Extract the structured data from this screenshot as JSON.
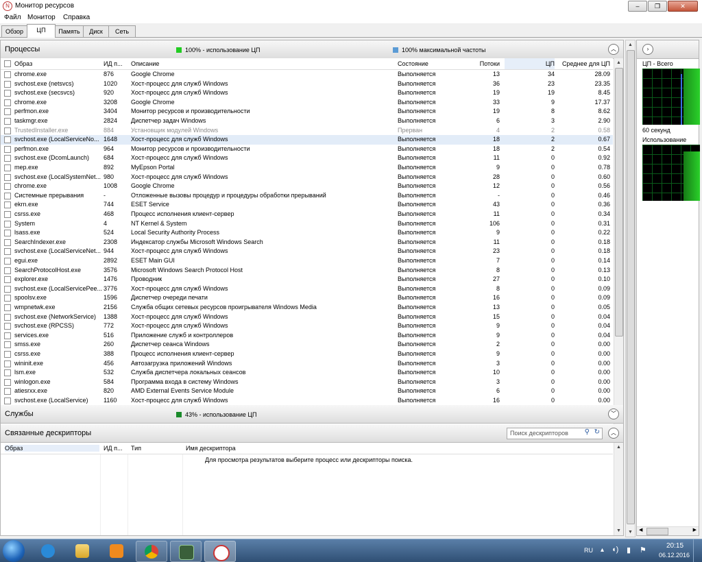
{
  "window": {
    "title": "Монитор ресурсов",
    "app_icon": "resource-monitor-icon",
    "min_glyph": "–",
    "max_glyph": "❐",
    "close_glyph": "✕"
  },
  "menu": [
    "Файл",
    "Монитор",
    "Справка"
  ],
  "tabs": [
    "Обзор",
    "ЦП",
    "Память",
    "Диск",
    "Сеть"
  ],
  "active_tab": "ЦП",
  "processes": {
    "title": "Процессы",
    "indicator_cpu": "100% - использование ЦП",
    "indicator_freq": "100% максимальной частоты",
    "indicator_cpu_color": "#22cc22",
    "indicator_freq_color": "#5b9bd5",
    "columns": [
      "Образ",
      "ИД п...",
      "Описание",
      "Состояние",
      "Потоки",
      "ЦП",
      "Среднее для ЦП"
    ],
    "rows": [
      [
        "chrome.exe",
        "876",
        "Google Chrome",
        "Выполняется",
        "13",
        "34",
        "28.09"
      ],
      [
        "svchost.exe (netsvcs)",
        "1020",
        "Хост-процесс для служб Windows",
        "Выполняется",
        "36",
        "23",
        "23.35"
      ],
      [
        "svchost.exe (secsvcs)",
        "920",
        "Хост-процесс для служб Windows",
        "Выполняется",
        "19",
        "19",
        "8.45"
      ],
      [
        "chrome.exe",
        "3208",
        "Google Chrome",
        "Выполняется",
        "33",
        "9",
        "17.37"
      ],
      [
        "perfmon.exe",
        "3404",
        "Монитор ресурсов и производительности",
        "Выполняется",
        "19",
        "8",
        "8.62"
      ],
      [
        "taskmgr.exe",
        "2824",
        "Диспетчер задач Windows",
        "Выполняется",
        "6",
        "3",
        "2.90"
      ],
      [
        "TrustedInstaller.exe",
        "884",
        "Установщик модулей Windows",
        "Прерван",
        "4",
        "2",
        "0.58"
      ],
      [
        "svchost.exe (LocalServiceNo...",
        "1648",
        "Хост-процесс для служб Windows",
        "Выполняется",
        "18",
        "2",
        "0.67"
      ],
      [
        "perfmon.exe",
        "964",
        "Монитор ресурсов и производительности",
        "Выполняется",
        "18",
        "2",
        "0.54"
      ],
      [
        "svchost.exe (DcomLaunch)",
        "684",
        "Хост-процесс для служб Windows",
        "Выполняется",
        "11",
        "0",
        "0.92"
      ],
      [
        "mep.exe",
        "892",
        "MyEpson Portal",
        "Выполняется",
        "9",
        "0",
        "0.78"
      ],
      [
        "svchost.exe (LocalSystemNet...",
        "980",
        "Хост-процесс для служб Windows",
        "Выполняется",
        "28",
        "0",
        "0.60"
      ],
      [
        "chrome.exe",
        "1008",
        "Google Chrome",
        "Выполняется",
        "12",
        "0",
        "0.56"
      ],
      [
        "Системные прерывания",
        "-",
        "Отложенные вызовы процедур и процедуры обработки прерываний",
        "Выполняется",
        "-",
        "0",
        "0.46"
      ],
      [
        "ekrn.exe",
        "744",
        "ESET Service",
        "Выполняется",
        "43",
        "0",
        "0.36"
      ],
      [
        "csrss.exe",
        "468",
        "Процесс исполнения клиент-сервер",
        "Выполняется",
        "11",
        "0",
        "0.34"
      ],
      [
        "System",
        "4",
        "NT Kernel & System",
        "Выполняется",
        "106",
        "0",
        "0.31"
      ],
      [
        "lsass.exe",
        "524",
        "Local Security Authority Process",
        "Выполняется",
        "9",
        "0",
        "0.22"
      ],
      [
        "SearchIndexer.exe",
        "2308",
        "Индексатор службы Microsoft Windows Search",
        "Выполняется",
        "11",
        "0",
        "0.18"
      ],
      [
        "svchost.exe (LocalServiceNet...",
        "944",
        "Хост-процесс для служб Windows",
        "Выполняется",
        "23",
        "0",
        "0.18"
      ],
      [
        "egui.exe",
        "2892",
        "ESET Main GUI",
        "Выполняется",
        "7",
        "0",
        "0.14"
      ],
      [
        "SearchProtocolHost.exe",
        "3576",
        "Microsoft Windows Search Protocol Host",
        "Выполняется",
        "8",
        "0",
        "0.13"
      ],
      [
        "explorer.exe",
        "1476",
        "Проводник",
        "Выполняется",
        "27",
        "0",
        "0.10"
      ],
      [
        "svchost.exe (LocalServicePee...",
        "3776",
        "Хост-процесс для служб Windows",
        "Выполняется",
        "8",
        "0",
        "0.09"
      ],
      [
        "spoolsv.exe",
        "1596",
        "Диспетчер очереди печати",
        "Выполняется",
        "16",
        "0",
        "0.09"
      ],
      [
        "wmpnetwk.exe",
        "2156",
        "Служба общих сетевых ресурсов проигрывателя Windows Media",
        "Выполняется",
        "13",
        "0",
        "0.05"
      ],
      [
        "svchost.exe (NetworkService)",
        "1388",
        "Хост-процесс для служб Windows",
        "Выполняется",
        "15",
        "0",
        "0.04"
      ],
      [
        "svchost.exe (RPCSS)",
        "772",
        "Хост-процесс для служб Windows",
        "Выполняется",
        "9",
        "0",
        "0.04"
      ],
      [
        "services.exe",
        "516",
        "Приложение служб и контроллеров",
        "Выполняется",
        "9",
        "0",
        "0.04"
      ],
      [
        "smss.exe",
        "260",
        "Диспетчер сеанса  Windows",
        "Выполняется",
        "2",
        "0",
        "0.00"
      ],
      [
        "csrss.exe",
        "388",
        "Процесс исполнения клиент-сервер",
        "Выполняется",
        "9",
        "0",
        "0.00"
      ],
      [
        "wininit.exe",
        "456",
        "Автозагрузка приложений Windows",
        "Выполняется",
        "3",
        "0",
        "0.00"
      ],
      [
        "lsm.exe",
        "532",
        "Служба диспетчера локальных сеансов",
        "Выполняется",
        "10",
        "0",
        "0.00"
      ],
      [
        "winlogon.exe",
        "584",
        "Программа входа в систему Windows",
        "Выполняется",
        "3",
        "0",
        "0.00"
      ],
      [
        "atiesrxx.exe",
        "820",
        "AMD External Events Service Module",
        "Выполняется",
        "6",
        "0",
        "0.00"
      ],
      [
        "svchost.exe (LocalService)",
        "1160",
        "Хост-процесс для служб Windows",
        "Выполняется",
        "16",
        "0",
        "0.00"
      ]
    ]
  },
  "services": {
    "title": "Службы",
    "indicator": "43% - использование ЦП",
    "indicator_color": "#1a8a2a"
  },
  "handles": {
    "title": "Связанные дескрипторы",
    "search_placeholder": "Поиск дескрипторов",
    "columns": [
      "Образ",
      "ИД п...",
      "Тип",
      "Имя дескриптора"
    ],
    "empty_message": "Для просмотра результатов выберите процесс или дескрипторы поиска."
  },
  "right_panel": {
    "graph1_title": "ЦП - Всего",
    "graph1_caption": "60 секунд",
    "graph2_title": "Использование"
  },
  "taskbar": {
    "apps": [
      "start-orb",
      "internet-explorer-icon",
      "file-explorer-icon",
      "media-player-icon",
      "chrome-icon",
      "task-manager-icon",
      "resource-monitor-icon"
    ],
    "language": "RU",
    "time": "20:15",
    "date": "06.12.2016"
  }
}
